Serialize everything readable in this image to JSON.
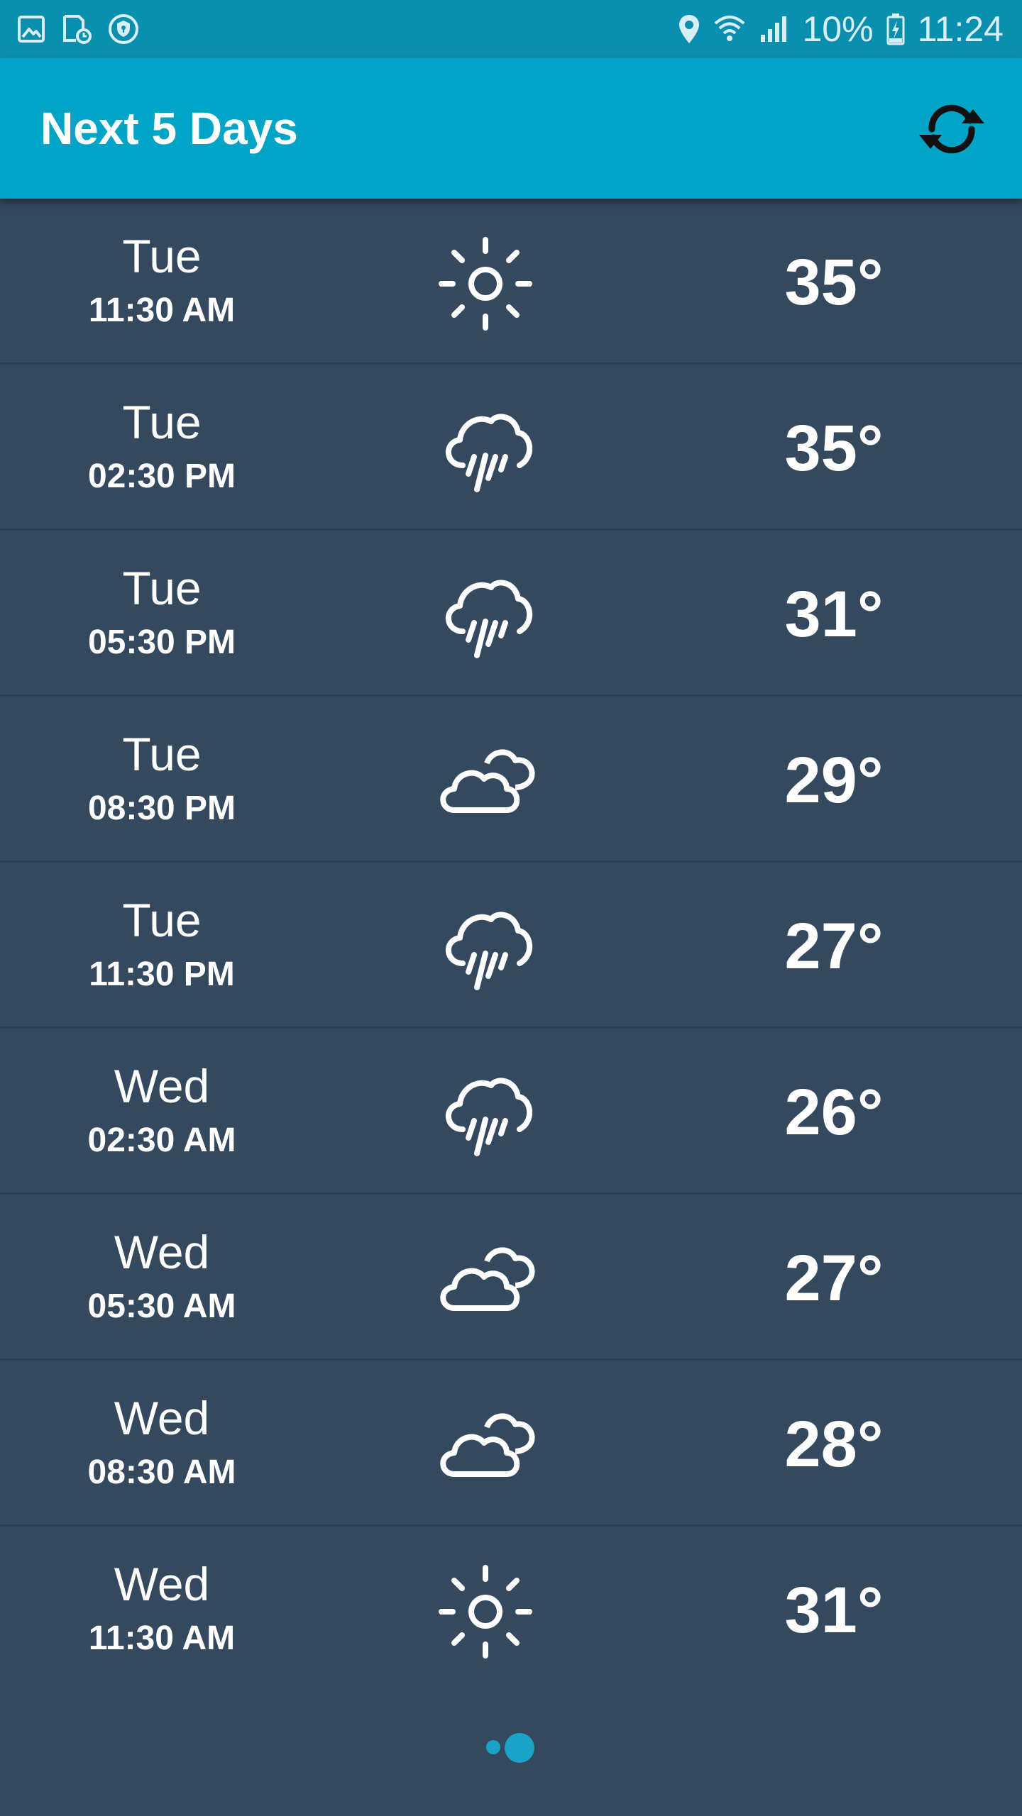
{
  "status_bar": {
    "battery": "10%",
    "time": "11:24",
    "icons": [
      "gallery-icon",
      "sd-card-icon",
      "vpn-shield-icon",
      "location-icon",
      "wifi-icon",
      "signal-icon",
      "battery-charging-icon"
    ]
  },
  "header": {
    "title": "Next 5 Days",
    "refresh_icon": "refresh-icon"
  },
  "forecast": [
    {
      "day": "Tue",
      "time": "11:30 AM",
      "icon": "sun-icon",
      "temp": "35°"
    },
    {
      "day": "Tue",
      "time": "02:30 PM",
      "icon": "rain-icon",
      "temp": "35°"
    },
    {
      "day": "Tue",
      "time": "05:30 PM",
      "icon": "rain-icon",
      "temp": "31°"
    },
    {
      "day": "Tue",
      "time": "08:30 PM",
      "icon": "clouds-icon",
      "temp": "29°"
    },
    {
      "day": "Tue",
      "time": "11:30 PM",
      "icon": "rain-icon",
      "temp": "27°"
    },
    {
      "day": "Wed",
      "time": "02:30 AM",
      "icon": "rain-icon",
      "temp": "26°"
    },
    {
      "day": "Wed",
      "time": "05:30 AM",
      "icon": "clouds-icon",
      "temp": "27°"
    },
    {
      "day": "Wed",
      "time": "08:30 AM",
      "icon": "clouds-icon",
      "temp": "28°"
    },
    {
      "day": "Wed",
      "time": "11:30 AM",
      "icon": "sun-icon",
      "temp": "31°"
    }
  ],
  "pager": {
    "pages": 2,
    "current": 2
  },
  "colors": {
    "status_bar": "#0b8fae",
    "app_bar": "#00a4c7",
    "background": "#35495e",
    "divider": "#2d4053",
    "pager_dot": "#1aa3c6"
  }
}
